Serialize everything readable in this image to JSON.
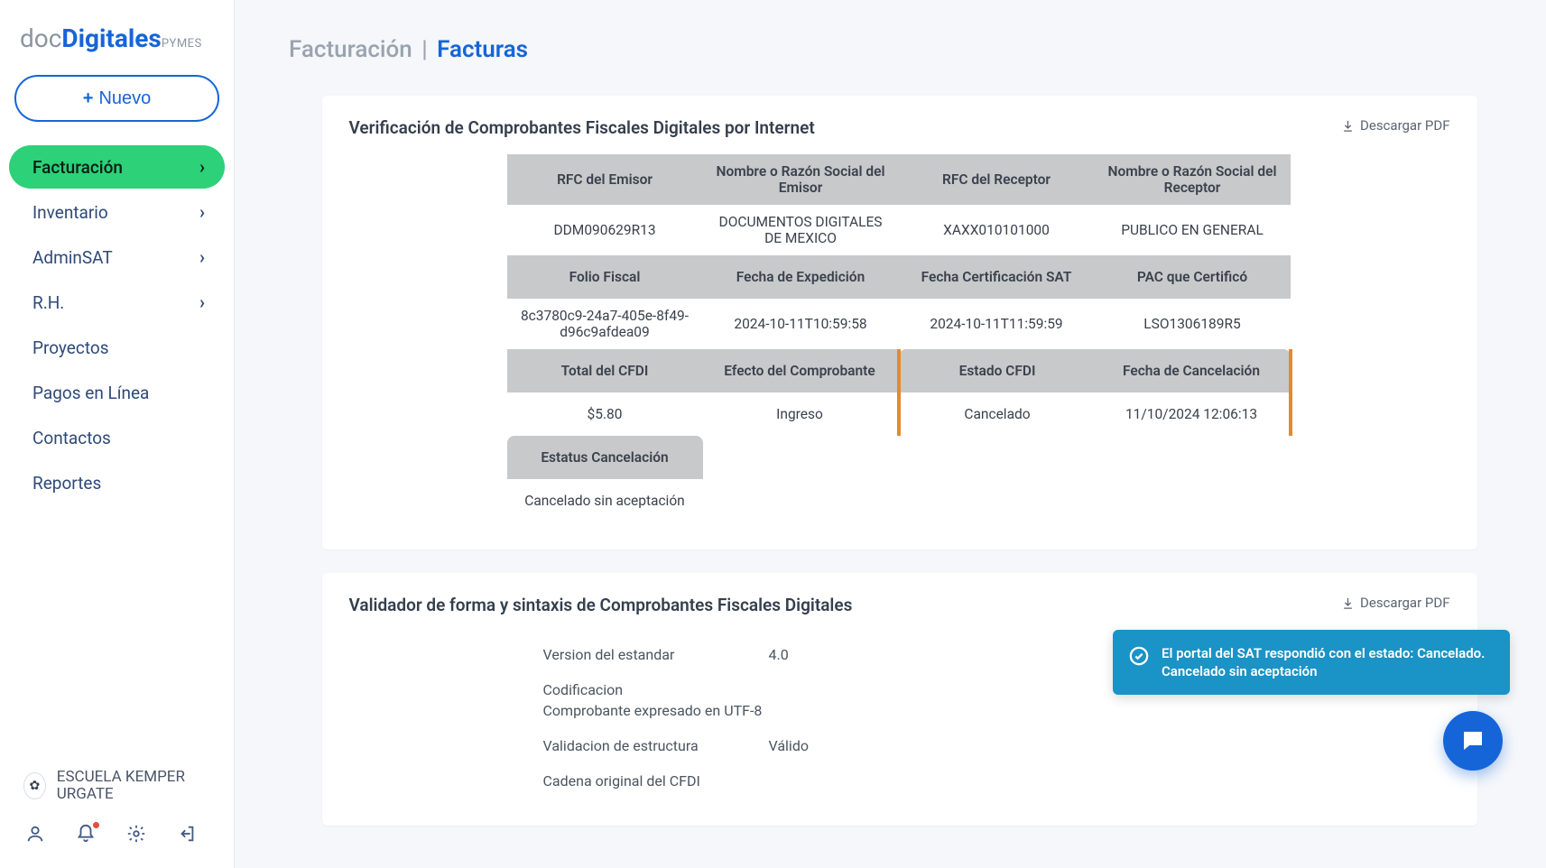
{
  "logo": {
    "part1": "doc",
    "part2": "Digitales",
    "part3": "PYMES"
  },
  "buttons": {
    "nuevo": "Nuevo",
    "download_pdf": "Descargar PDF"
  },
  "sidebar": {
    "items": [
      {
        "label": "Facturación",
        "expandable": true,
        "active": true
      },
      {
        "label": "Inventario",
        "expandable": true,
        "active": false
      },
      {
        "label": "AdminSAT",
        "expandable": true,
        "active": false
      },
      {
        "label": "R.H.",
        "expandable": true,
        "active": false
      },
      {
        "label": "Proyectos",
        "expandable": false,
        "active": false
      },
      {
        "label": "Pagos en Línea",
        "expandable": false,
        "active": false
      },
      {
        "label": "Contactos",
        "expandable": false,
        "active": false
      },
      {
        "label": "Reportes",
        "expandable": false,
        "active": false
      }
    ],
    "user": "ESCUELA KEMPER URGATE"
  },
  "breadcrumb": {
    "section": "Facturación",
    "page": "Facturas"
  },
  "verification": {
    "title": "Verificación de Comprobantes Fiscales Digitales por Internet",
    "headers": {
      "rfc_emisor": "RFC del Emisor",
      "nombre_emisor": "Nombre o Razón Social del Emisor",
      "rfc_receptor": "RFC del Receptor",
      "nombre_receptor": "Nombre o Razón Social del Receptor",
      "folio": "Folio Fiscal",
      "fecha_exp": "Fecha de Expedición",
      "fecha_cert": "Fecha Certificación SAT",
      "pac": "PAC que Certificó",
      "total": "Total del CFDI",
      "efecto": "Efecto del Comprobante",
      "estado": "Estado CFDI",
      "fecha_cancel": "Fecha de Cancelación",
      "estatus_cancel": "Estatus Cancelación"
    },
    "values": {
      "rfc_emisor": "DDM090629R13",
      "nombre_emisor": "DOCUMENTOS DIGITALES DE MEXICO",
      "rfc_receptor": "XAXX010101000",
      "nombre_receptor": "PUBLICO EN GENERAL",
      "folio": "8c3780c9-24a7-405e-8f49-d96c9afdea09",
      "fecha_exp": "2024-10-11T10:59:58",
      "fecha_cert": "2024-10-11T11:59:59",
      "pac": "LSO1306189R5",
      "total": "$5.80",
      "efecto": "Ingreso",
      "estado": "Cancelado",
      "fecha_cancel": "11/10/2024 12:06:13",
      "estatus_cancel": "Cancelado sin aceptación"
    }
  },
  "validator": {
    "title": "Validador de forma y sintaxis de Comprobantes Fiscales Digitales",
    "rows": {
      "version_k": "Version del estandar",
      "version_v": "4.0",
      "codif_k": "Codificacion",
      "codif_v": "Comprobante expresado en UTF-8",
      "valid_k": "Validacion de estructura",
      "valid_v": "Válido",
      "cadena_k": "Cadena original del CFDI"
    }
  },
  "toast": {
    "text": "El portal del SAT respondió con el estado: Cancelado. Cancelado sin aceptación"
  }
}
